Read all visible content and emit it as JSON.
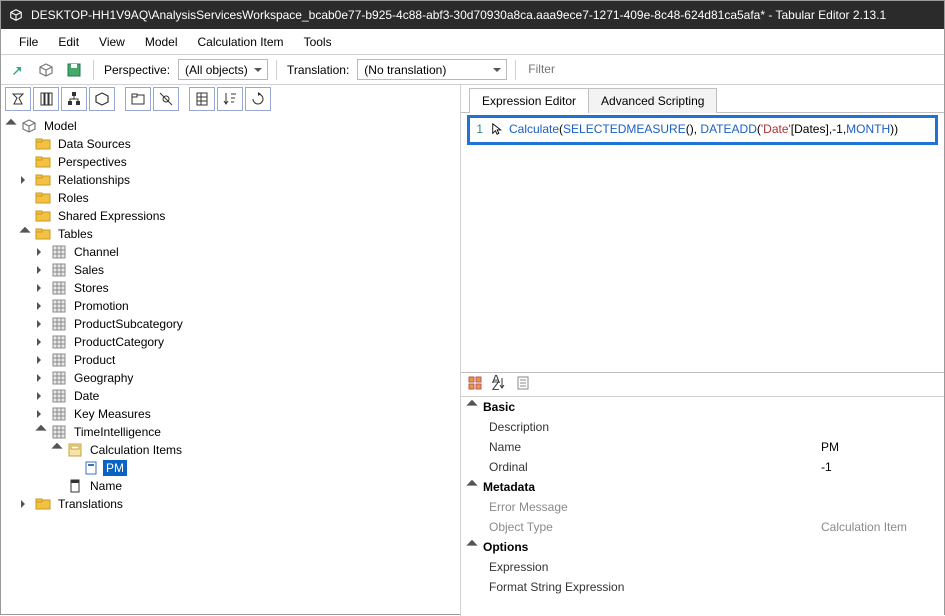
{
  "titlebar": {
    "text": "DESKTOP-HH1V9AQ\\AnalysisServicesWorkspace_bcab0e77-b925-4c88-abf3-30d70930a8ca.aaa9ece7-1271-409e-8c48-624d81ca5afa* - Tabular Editor 2.13.1"
  },
  "menu": {
    "file": "File",
    "edit": "Edit",
    "view": "View",
    "model": "Model",
    "calc": "Calculation Item",
    "tools": "Tools"
  },
  "toolbar": {
    "perspective_label": "Perspective:",
    "perspective_value": "(All objects)",
    "translation_label": "Translation:",
    "translation_value": "(No translation)",
    "filter_placeholder": "Filter"
  },
  "tree": {
    "root": "Model",
    "data_sources": "Data Sources",
    "perspectives": "Perspectives",
    "relationships": "Relationships",
    "roles": "Roles",
    "shared_expr": "Shared Expressions",
    "tables": "Tables",
    "t_channel": "Channel",
    "t_sales": "Sales",
    "t_stores": "Stores",
    "t_promotion": "Promotion",
    "t_prodsub": "ProductSubcategory",
    "t_prodcat": "ProductCategory",
    "t_product": "Product",
    "t_geo": "Geography",
    "t_date": "Date",
    "t_keym": "Key Measures",
    "t_ti": "TimeIntelligence",
    "calc_items": "Calculation Items",
    "pm": "PM",
    "name_col": "Name",
    "translations": "Translations"
  },
  "tabs": {
    "expr": "Expression Editor",
    "script": "Advanced Scripting"
  },
  "editor": {
    "line_no": "1",
    "tok_calc": "Calculate",
    "tok_lp1": "(",
    "tok_sel": "SELECTEDMEASURE",
    "tok_lp2": "()",
    "tok_com": ", ",
    "tok_da": "DATEADD",
    "tok_lp3": "(",
    "tok_str1": "'Date'",
    "tok_br": "[Dates]",
    "tok_com2": ",",
    "tok_n1": "-1",
    "tok_com3": ",",
    "tok_month": "MONTH",
    "tok_rp": "))"
  },
  "props": {
    "cat_basic": "Basic",
    "desc": "Description",
    "name_k": "Name",
    "name_v": "PM",
    "ord_k": "Ordinal",
    "ord_v": "-1",
    "cat_meta": "Metadata",
    "err": "Error Message",
    "otype_k": "Object Type",
    "otype_v": "Calculation Item",
    "cat_opt": "Options",
    "expr": "Expression",
    "fmt": "Format String Expression"
  }
}
